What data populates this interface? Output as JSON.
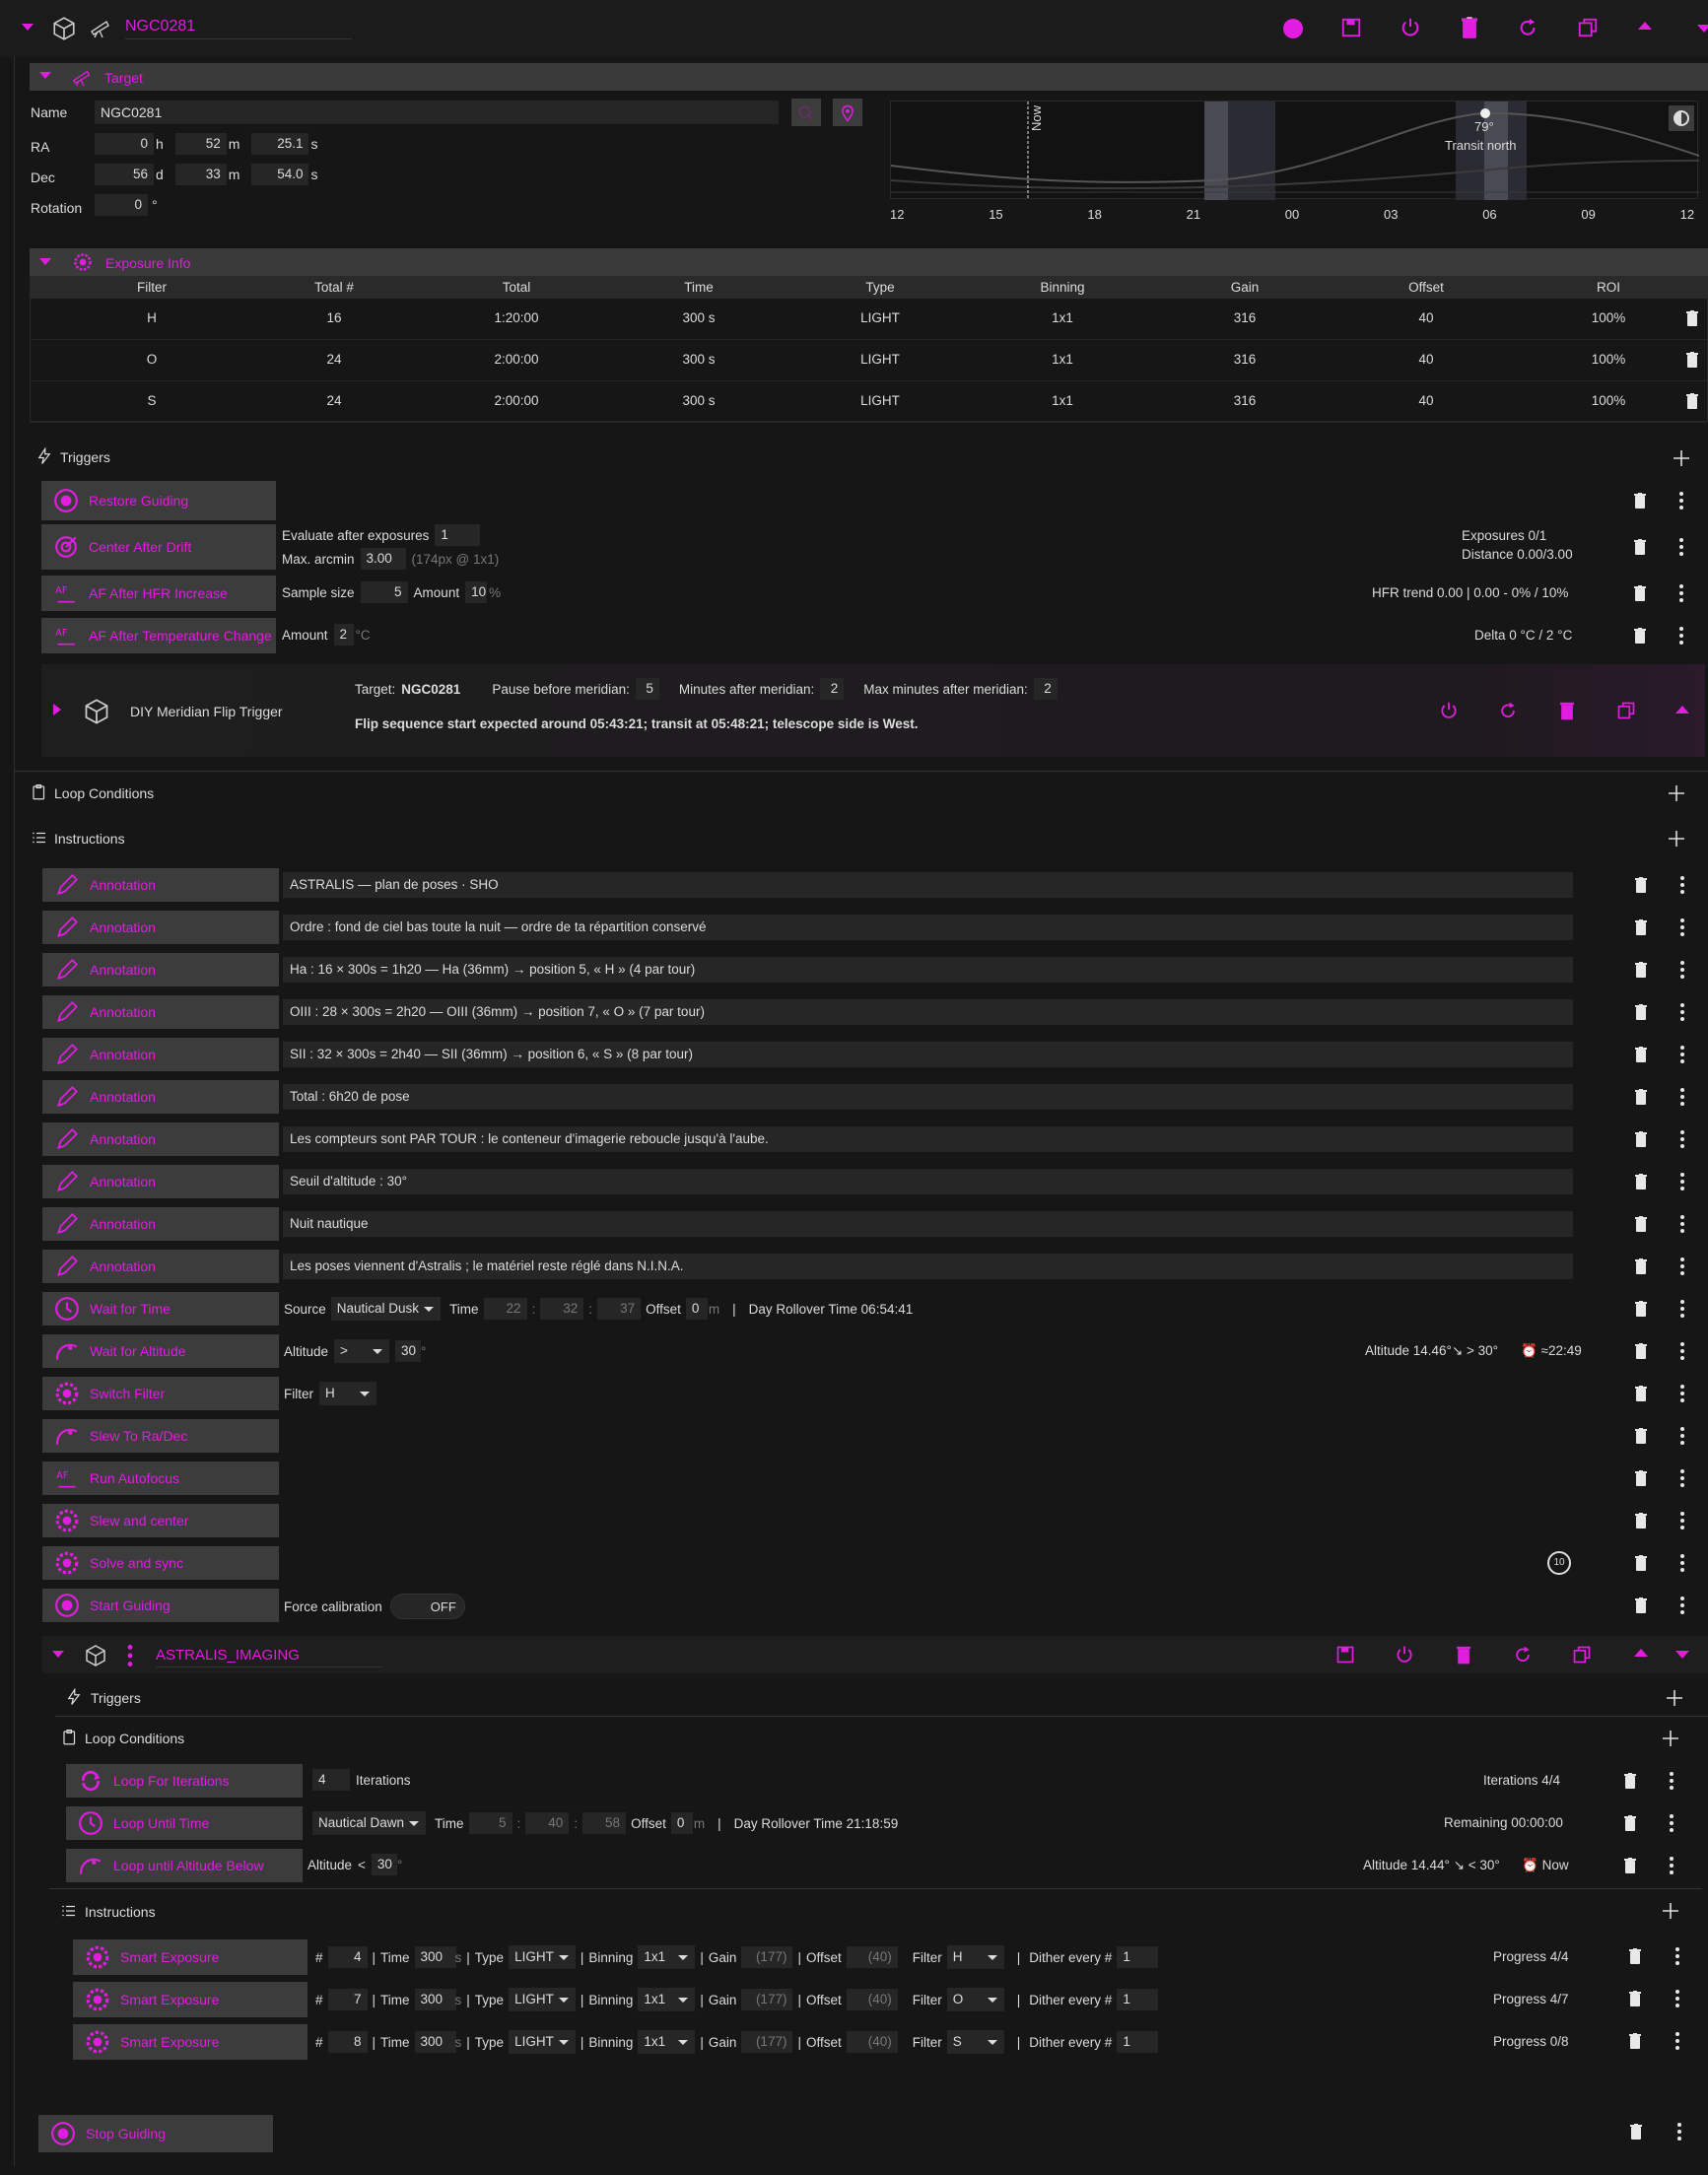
{
  "top": {
    "title": "NGC0281"
  },
  "target": {
    "section_title": "Target",
    "name_label": "Name",
    "name_value": "NGC0281",
    "ra_label": "RA",
    "ra_h": "0",
    "ra_h_unit": "h",
    "ra_m": "52",
    "ra_m_unit": "m",
    "ra_s": "25.1",
    "ra_s_unit": "s",
    "dec_label": "Dec",
    "dec_d": "56",
    "dec_d_unit": "d",
    "dec_m": "33",
    "dec_m_unit": "m",
    "dec_s": "54.0",
    "dec_s_unit": "s",
    "rot_label": "Rotation",
    "rot_value": "0",
    "rot_unit": "°",
    "chart": {
      "now_label": "Now",
      "transit_alt": "79°",
      "transit_label": "Transit north",
      "ticks": [
        "12",
        "15",
        "18",
        "21",
        "00",
        "03",
        "06",
        "09",
        "12"
      ]
    }
  },
  "exposure_info": {
    "title": "Exposure Info",
    "headers": [
      "Filter",
      "Total #",
      "Total",
      "Time",
      "Type",
      "Binning",
      "Gain",
      "Offset",
      "ROI"
    ],
    "rows": [
      [
        "H",
        "16",
        "1:20:00",
        "300 s",
        "LIGHT",
        "1x1",
        "316",
        "40",
        "100%"
      ],
      [
        "O",
        "24",
        "2:00:00",
        "300 s",
        "LIGHT",
        "1x1",
        "316",
        "40",
        "100%"
      ],
      [
        "S",
        "24",
        "2:00:00",
        "300 s",
        "LIGHT",
        "1x1",
        "316",
        "40",
        "100%"
      ]
    ]
  },
  "triggers": {
    "title": "Triggers",
    "restore": "Restore Guiding",
    "center": "Center After Drift",
    "center_eval_label": "Evaluate after exposures",
    "center_eval_value": "1",
    "center_arc_label": "Max. arcmin",
    "center_arc_value": "3.00",
    "center_arc_hint": "(174px @ 1x1)",
    "center_status1": "Exposures 0/1",
    "center_status2": "Distance 0.00/3.00",
    "hfr": "AF After HFR Increase",
    "hfr_sample_label": "Sample size",
    "hfr_sample_value": "5",
    "hfr_amount_label": "Amount",
    "hfr_amount_value": "10",
    "hfr_amount_unit": "%",
    "hfr_status": "HFR trend 0.00 | 0.00 - 0% / 10%",
    "temp": "AF After Temperature Change",
    "temp_amount_label": "Amount",
    "temp_amount_value": "2",
    "temp_amount_unit": "°C",
    "temp_status": "Delta 0 °C / 2 °C",
    "diy_title": "DIY Meridian Flip Trigger",
    "diy_target_label": "Target:",
    "diy_target_value": "NGC0281",
    "diy_pause_label": "Pause before meridian:",
    "diy_pause_value": "5",
    "diy_after_label": "Minutes after meridian:",
    "diy_after_value": "2",
    "diy_max_label": "Max minutes after meridian:",
    "diy_max_value": "2",
    "diy_note": "Flip sequence start expected around 05:43:21; transit at 05:48:21; telescope side is West."
  },
  "loop_conditions": {
    "title": "Loop Conditions"
  },
  "instructions": {
    "title": "Instructions",
    "annotation_label": "Annotation",
    "annotations": [
      "ASTRALIS — plan de poses · SHO",
      "Ordre : fond de ciel bas toute la nuit — ordre de ta répartition conservé",
      "Ha : 16 × 300s = 1h20 — Ha (36mm) → position 5, « H » (4 par tour)",
      "OIII : 28 × 300s = 2h20 — OIII (36mm) → position 7, « O » (7 par tour)",
      "SII : 32 × 300s = 2h40 — SII (36mm) → position 6, « S » (8 par tour)",
      "Total : 6h20 de pose",
      "Les compteurs sont PAR TOUR : le conteneur d'imagerie reboucle jusqu'à l'aube.",
      "Seuil d'altitude : 30°",
      "Nuit nautique",
      "Les poses viennent d'Astralis ; le matériel reste réglé dans N.I.N.A."
    ],
    "wait_time": "Wait for Time",
    "wt_source_label": "Source",
    "wt_source": "Nautical Dusk",
    "wt_time_label": "Time",
    "wt_h": "22",
    "wt_m": "32",
    "wt_s": "37",
    "wt_offset_label": "Offset",
    "wt_offset": "0",
    "wt_offset_unit": "m",
    "wt_rollover": "Day Rollover Time 06:54:41",
    "wait_alt": "Wait for Altitude",
    "wa_label": "Altitude",
    "wa_cmp": ">",
    "wa_value": "30",
    "wa_unit": "°",
    "wa_status": "Altitude 14.46°↘ > 30°",
    "wa_eta": "≈22:49",
    "switch_filter": "Switch Filter",
    "sf_label": "Filter",
    "sf_value": "H",
    "slew": "Slew To Ra/Dec",
    "autofocus": "Run Autofocus",
    "slew_center": "Slew and center",
    "solve_sync": "Solve and sync",
    "start_guiding": "Start Guiding",
    "sg_label": "Force calibration",
    "sg_toggle": "OFF",
    "retry_badge": "10"
  },
  "imaging": {
    "title": "ASTRALIS_IMAGING",
    "triggers_title": "Triggers",
    "loop_title": "Loop Conditions",
    "loop_iter": "Loop For Iterations",
    "li_value": "4",
    "li_label": "Iterations",
    "li_status": "Iterations 4/4",
    "loop_time": "Loop Until Time",
    "lt_source": "Nautical Dawn",
    "lt_time_label": "Time",
    "lt_h": "5",
    "lt_m": "40",
    "lt_s": "58",
    "lt_offset_label": "Offset",
    "lt_offset": "0",
    "lt_offset_unit": "m",
    "lt_rollover": "Day Rollover Time 21:18:59",
    "lt_status": "Remaining 00:00:00",
    "loop_alt": "Loop until Altitude Below",
    "la_label": "Altitude",
    "la_cmp": "<",
    "la_value": "30",
    "la_unit": "°",
    "la_status": "Altitude 14.44° ↘ < 30°",
    "la_eta": "Now",
    "instr_title": "Instructions",
    "smart_label": "Smart Exposure",
    "f_hash": "#",
    "f_time": "Time",
    "f_s": "s",
    "f_type": "Type",
    "f_binning": "Binning",
    "f_gain": "Gain",
    "f_offset": "Offset",
    "f_filter": "Filter",
    "f_dither": "Dither every #",
    "exposures": [
      {
        "count": "4",
        "time": "300",
        "type": "LIGHT",
        "binning": "1x1",
        "gain": "(177)",
        "offset": "(40)",
        "filter": "H",
        "dither": "1",
        "progress": "Progress 4/4"
      },
      {
        "count": "7",
        "time": "300",
        "type": "LIGHT",
        "binning": "1x1",
        "gain": "(177)",
        "offset": "(40)",
        "filter": "O",
        "dither": "1",
        "progress": "Progress 4/7"
      },
      {
        "count": "8",
        "time": "300",
        "type": "LIGHT",
        "binning": "1x1",
        "gain": "(177)",
        "offset": "(40)",
        "filter": "S",
        "dither": "1",
        "progress": "Progress 0/8"
      }
    ]
  },
  "stop_guiding": "Stop Guiding",
  "colors": {
    "accent": "#e11de0",
    "bg": "#161616",
    "panel": "#3c3c3c"
  }
}
